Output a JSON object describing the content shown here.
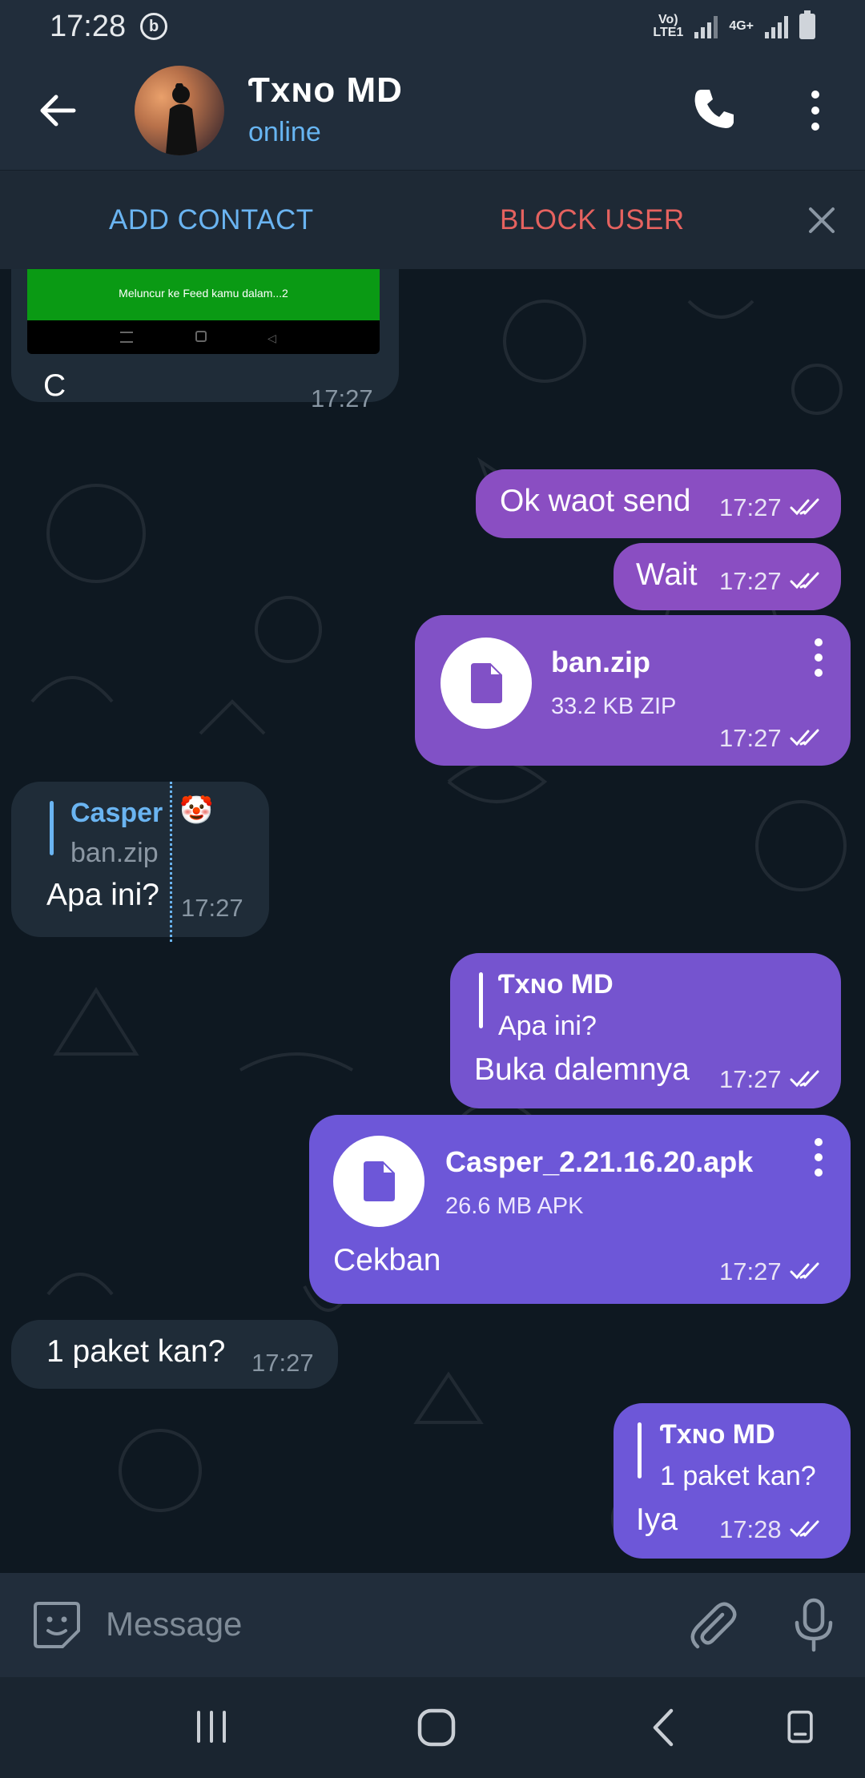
{
  "status": {
    "time": "17:28",
    "network_left": "Vo)\nLTE1",
    "network_right": "4G+"
  },
  "header": {
    "title": "Ƭxɴᴏ MD",
    "subtitle": "online"
  },
  "actions": {
    "add_contact": "ADD CONTACT",
    "block_user": "BLOCK USER"
  },
  "messages": {
    "m0": {
      "caption": "C",
      "time": "17:27",
      "preview_text": "Meluncur ke Feed kamu dalam...2"
    },
    "m1": {
      "text": "Ok waot send",
      "time": "17:27"
    },
    "m2": {
      "text": "Wait",
      "time": "17:27"
    },
    "m3": {
      "file_name": "ban.zip",
      "file_size": "33.2 KB ZIP",
      "time": "17:27"
    },
    "m4": {
      "reply_name": "Casper",
      "reply_text": "ban.zip",
      "text": "Apa ini?",
      "time": "17:27"
    },
    "m5": {
      "reply_name": "Ƭxɴᴏ MD",
      "reply_text": "Apa ini?",
      "text": "Buka dalemnya",
      "time": "17:27"
    },
    "m6": {
      "file_name": "Casper_2.21.16.20.apk",
      "file_size": "26.6 MB APK",
      "caption": "Cekban",
      "time": "17:27"
    },
    "m7": {
      "text": "1 paket kan?",
      "time": "17:27"
    },
    "m8": {
      "reply_name": "Ƭxɴᴏ MD",
      "reply_text": "1 paket kan?",
      "text": "Iya",
      "time": "17:28"
    }
  },
  "input": {
    "placeholder": "Message"
  },
  "colors": {
    "accent": "#6ab4f1",
    "danger": "#e5625f",
    "outgoing": "#8151c6",
    "incoming": "#1f2c38"
  }
}
